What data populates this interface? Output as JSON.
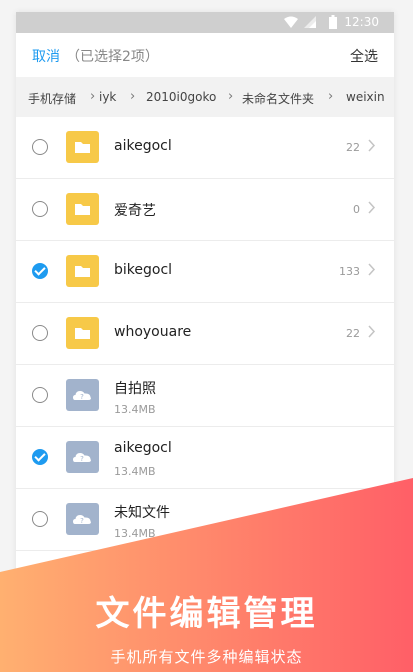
{
  "status_bar": {
    "time": "12:30"
  },
  "header": {
    "cancel_label": "取消",
    "selected_text": "（已选择2项）",
    "select_all_label": "全选"
  },
  "breadcrumb": {
    "items": [
      "手机存储",
      "iyk",
      "2010i0goko",
      "未命名文件夹",
      "weixin"
    ]
  },
  "files": [
    {
      "name": "aikegocl",
      "type": "folder",
      "count": "22",
      "checked": false
    },
    {
      "name": "爱奇艺",
      "type": "folder",
      "count": "0",
      "checked": false
    },
    {
      "name": "bikegocl",
      "type": "folder",
      "count": "133",
      "checked": true
    },
    {
      "name": "whoyouare",
      "type": "folder",
      "count": "22",
      "checked": false
    },
    {
      "name": "自拍照",
      "type": "image",
      "size": "13.4MB",
      "checked": false
    },
    {
      "name": "aikegocl",
      "type": "image",
      "size": "13.4MB",
      "checked": true
    },
    {
      "name": "未知文件",
      "type": "image",
      "size": "13.4MB",
      "checked": false
    }
  ],
  "banner": {
    "title": "文件编辑管理",
    "subtitle": "手机所有文件多种编辑状态"
  },
  "colors": {
    "accent": "#1e9bf0",
    "folder": "#f7c948",
    "image_icon": "#a2b3cc",
    "banner_from": "#ffb070",
    "banner_to": "#ff5f67"
  }
}
